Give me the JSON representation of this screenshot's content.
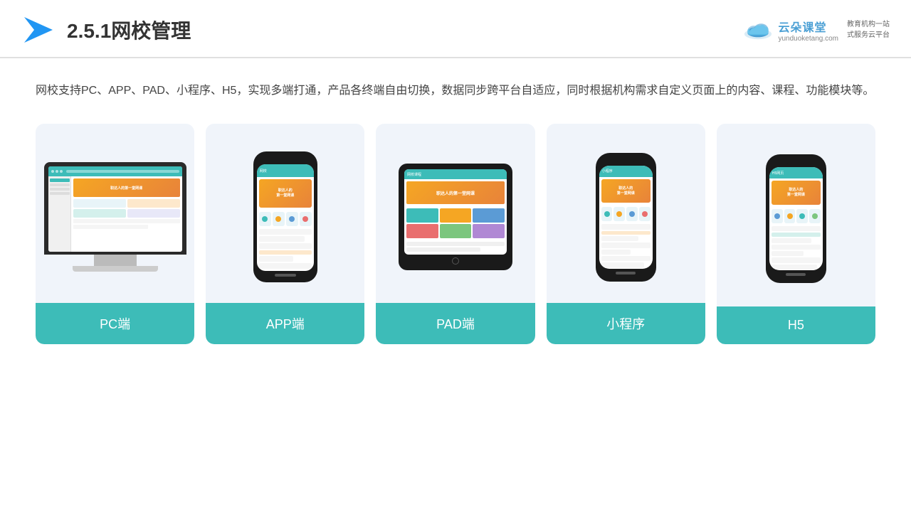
{
  "header": {
    "title": "2.5.1网校管理",
    "title_num": "2.5.1",
    "title_text": "网校管理",
    "brand_name": "云朵课堂",
    "brand_url": "yunduoketang.com",
    "brand_slogan": "教育机构一站\n式服务云平台"
  },
  "description": "网校支持PC、APP、PAD、小程序、H5，实现多端打通，产品各终端自由切换，数据同步跨平台自适应，同时根据机构需求自定义页面上的内容、课程、功能模块等。",
  "cards": [
    {
      "id": "pc",
      "label": "PC端"
    },
    {
      "id": "app",
      "label": "APP端"
    },
    {
      "id": "pad",
      "label": "PAD端"
    },
    {
      "id": "miniprogram",
      "label": "小程序"
    },
    {
      "id": "h5",
      "label": "H5"
    }
  ],
  "colors": {
    "teal": "#3dbcb8",
    "accent": "#f5a623",
    "card_bg": "#f0f4fa"
  }
}
